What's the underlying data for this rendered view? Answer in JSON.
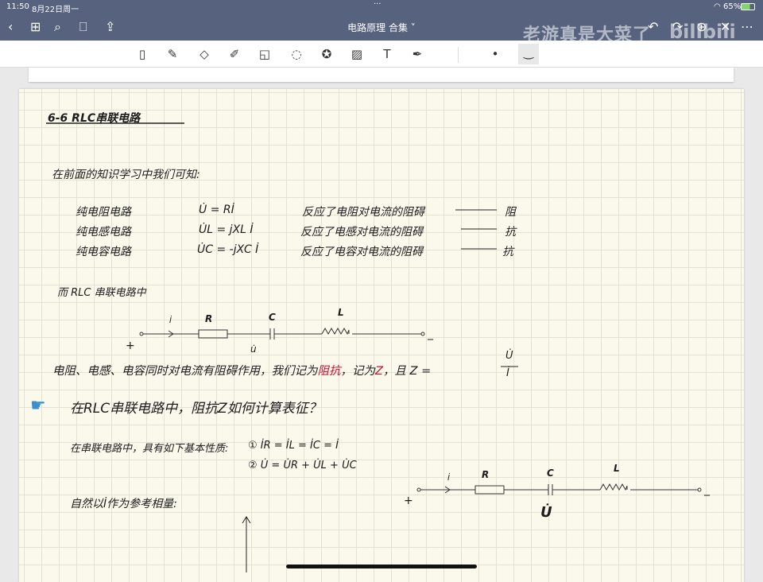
{
  "status": {
    "time": "11:50",
    "date": "8月22日周一",
    "battery": "65%"
  },
  "nav": {
    "title": "电路原理 合集 ˅",
    "watermark": "老游真是大菜了",
    "brand": "bilibili"
  },
  "toolbar": {
    "tools": [
      "sidebar",
      "pen",
      "eraser",
      "highlighter",
      "shapes",
      "lasso",
      "stickers",
      "image",
      "text",
      "laser-pointer"
    ]
  },
  "notes": {
    "title": "6-6  RLC串联电路",
    "intro": "在前面的知识学习中我们可知:",
    "rows": [
      {
        "circuit": "纯电阻电路",
        "eq": "U̇ = Rİ",
        "desc": "反应了电阻对电流的阻碍",
        "term": "阻"
      },
      {
        "circuit": "纯电感电路",
        "eq": "U̇L = jXL İ",
        "desc": "反应了电感对电流的阻碍",
        "term": "抗"
      },
      {
        "circuit": "纯电容电路",
        "eq": "U̇C = -jXC İ",
        "desc": "反应了电容对电流的阻碍",
        "term": "抗"
      }
    ],
    "rlc_intro": "而 RLC 串联电路中",
    "circuit": {
      "i": "İ",
      "R": "R",
      "C": "C",
      "L": "L",
      "plus": "+",
      "minus": "_",
      "u": "u̇",
      "U": "U̇"
    },
    "sentence_a": "电阻、电感、电容同时对电流有阻碍作用，我们记为",
    "impedance": "阻抗",
    "sentence_b": "，记为",
    "Z": "Z",
    "sentence_c": "，且 Z =",
    "frac_num": "U̇",
    "frac_den": "İ",
    "question": "在RLC串联电路中，阻抗Z如何计算表征？",
    "props_label": "在串联电路中，具有如下基本性质:",
    "prop1": "① İR = İL = İC = İ",
    "prop2": "② U̇ = U̇R + U̇L + U̇C",
    "reference": "自然以İ作为参考相量:"
  }
}
